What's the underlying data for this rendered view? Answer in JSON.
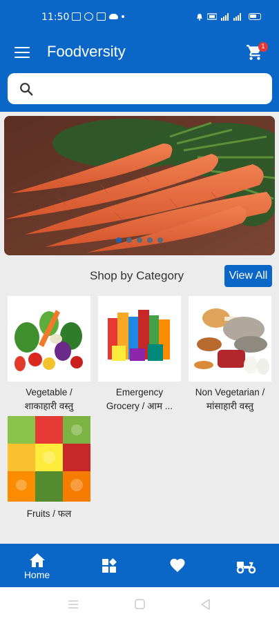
{
  "status_bar": {
    "time": "11:50"
  },
  "app_bar": {
    "title": "Foodversity",
    "cart_count": "1"
  },
  "search": {
    "placeholder": ""
  },
  "banner": {
    "slides": 5,
    "active_slide": 1
  },
  "section": {
    "title": "Shop by Category",
    "view_all_label": "View All"
  },
  "categories": [
    {
      "line1": "Vegetable /",
      "line2": "शाकाहारी वस्तु"
    },
    {
      "line1": "Emergency",
      "line2": "Grocery / आम ..."
    },
    {
      "line1": "Non Vegetarian /",
      "line2": "मांसाहारी वस्तु"
    },
    {
      "line1": "Fruits / फल",
      "line2": ""
    }
  ],
  "bottom_nav": {
    "items": [
      {
        "label": "Home",
        "icon": "home-icon",
        "active": true
      },
      {
        "label": "",
        "icon": "categories-icon"
      },
      {
        "label": "",
        "icon": "heart-icon"
      },
      {
        "label": "",
        "icon": "delivery-scooter-icon"
      }
    ]
  },
  "colors": {
    "primary": "#0b67c7",
    "background": "#ececec",
    "badge": "#e53935"
  }
}
